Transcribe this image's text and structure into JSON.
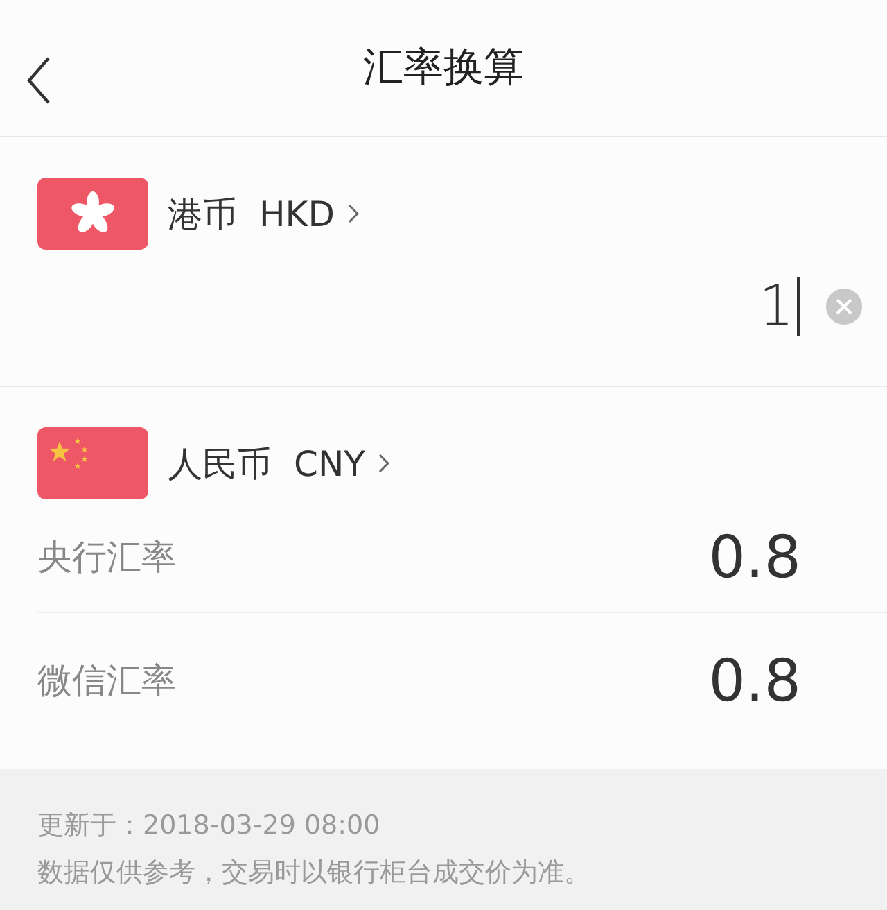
{
  "header": {
    "title": "汇率换算"
  },
  "source": {
    "kind": "hk",
    "name": "港币",
    "code": "HKD",
    "amount": "1"
  },
  "target": {
    "kind": "cn",
    "name": "人民币",
    "code": "CNY"
  },
  "rates": [
    {
      "label": "央行汇率",
      "value": "0.8"
    },
    {
      "label": "微信汇率",
      "value": "0.8"
    }
  ],
  "footer": {
    "updated": "更新于：2018-03-29 08:00",
    "note": "数据仅供参考，交易时以银行柜台成交价为准。"
  }
}
